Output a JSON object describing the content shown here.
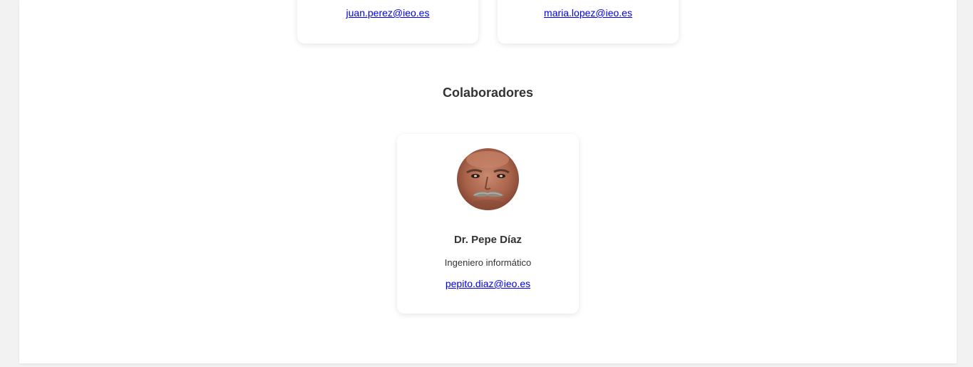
{
  "team": {
    "members": [
      {
        "email": "juan.perez@ieo.es"
      },
      {
        "email": "maria.lopez@ieo.es"
      }
    ]
  },
  "collaborators": {
    "title": "Colaboradores",
    "items": [
      {
        "name": "Dr. Pepe Díaz",
        "role": "Ingeniero informático",
        "email": "pepito.diaz@ieo.es"
      }
    ]
  },
  "colors": {
    "link": "#0000ee",
    "background": "#f2f2f2",
    "card": "#ffffff",
    "text": "#333333"
  }
}
